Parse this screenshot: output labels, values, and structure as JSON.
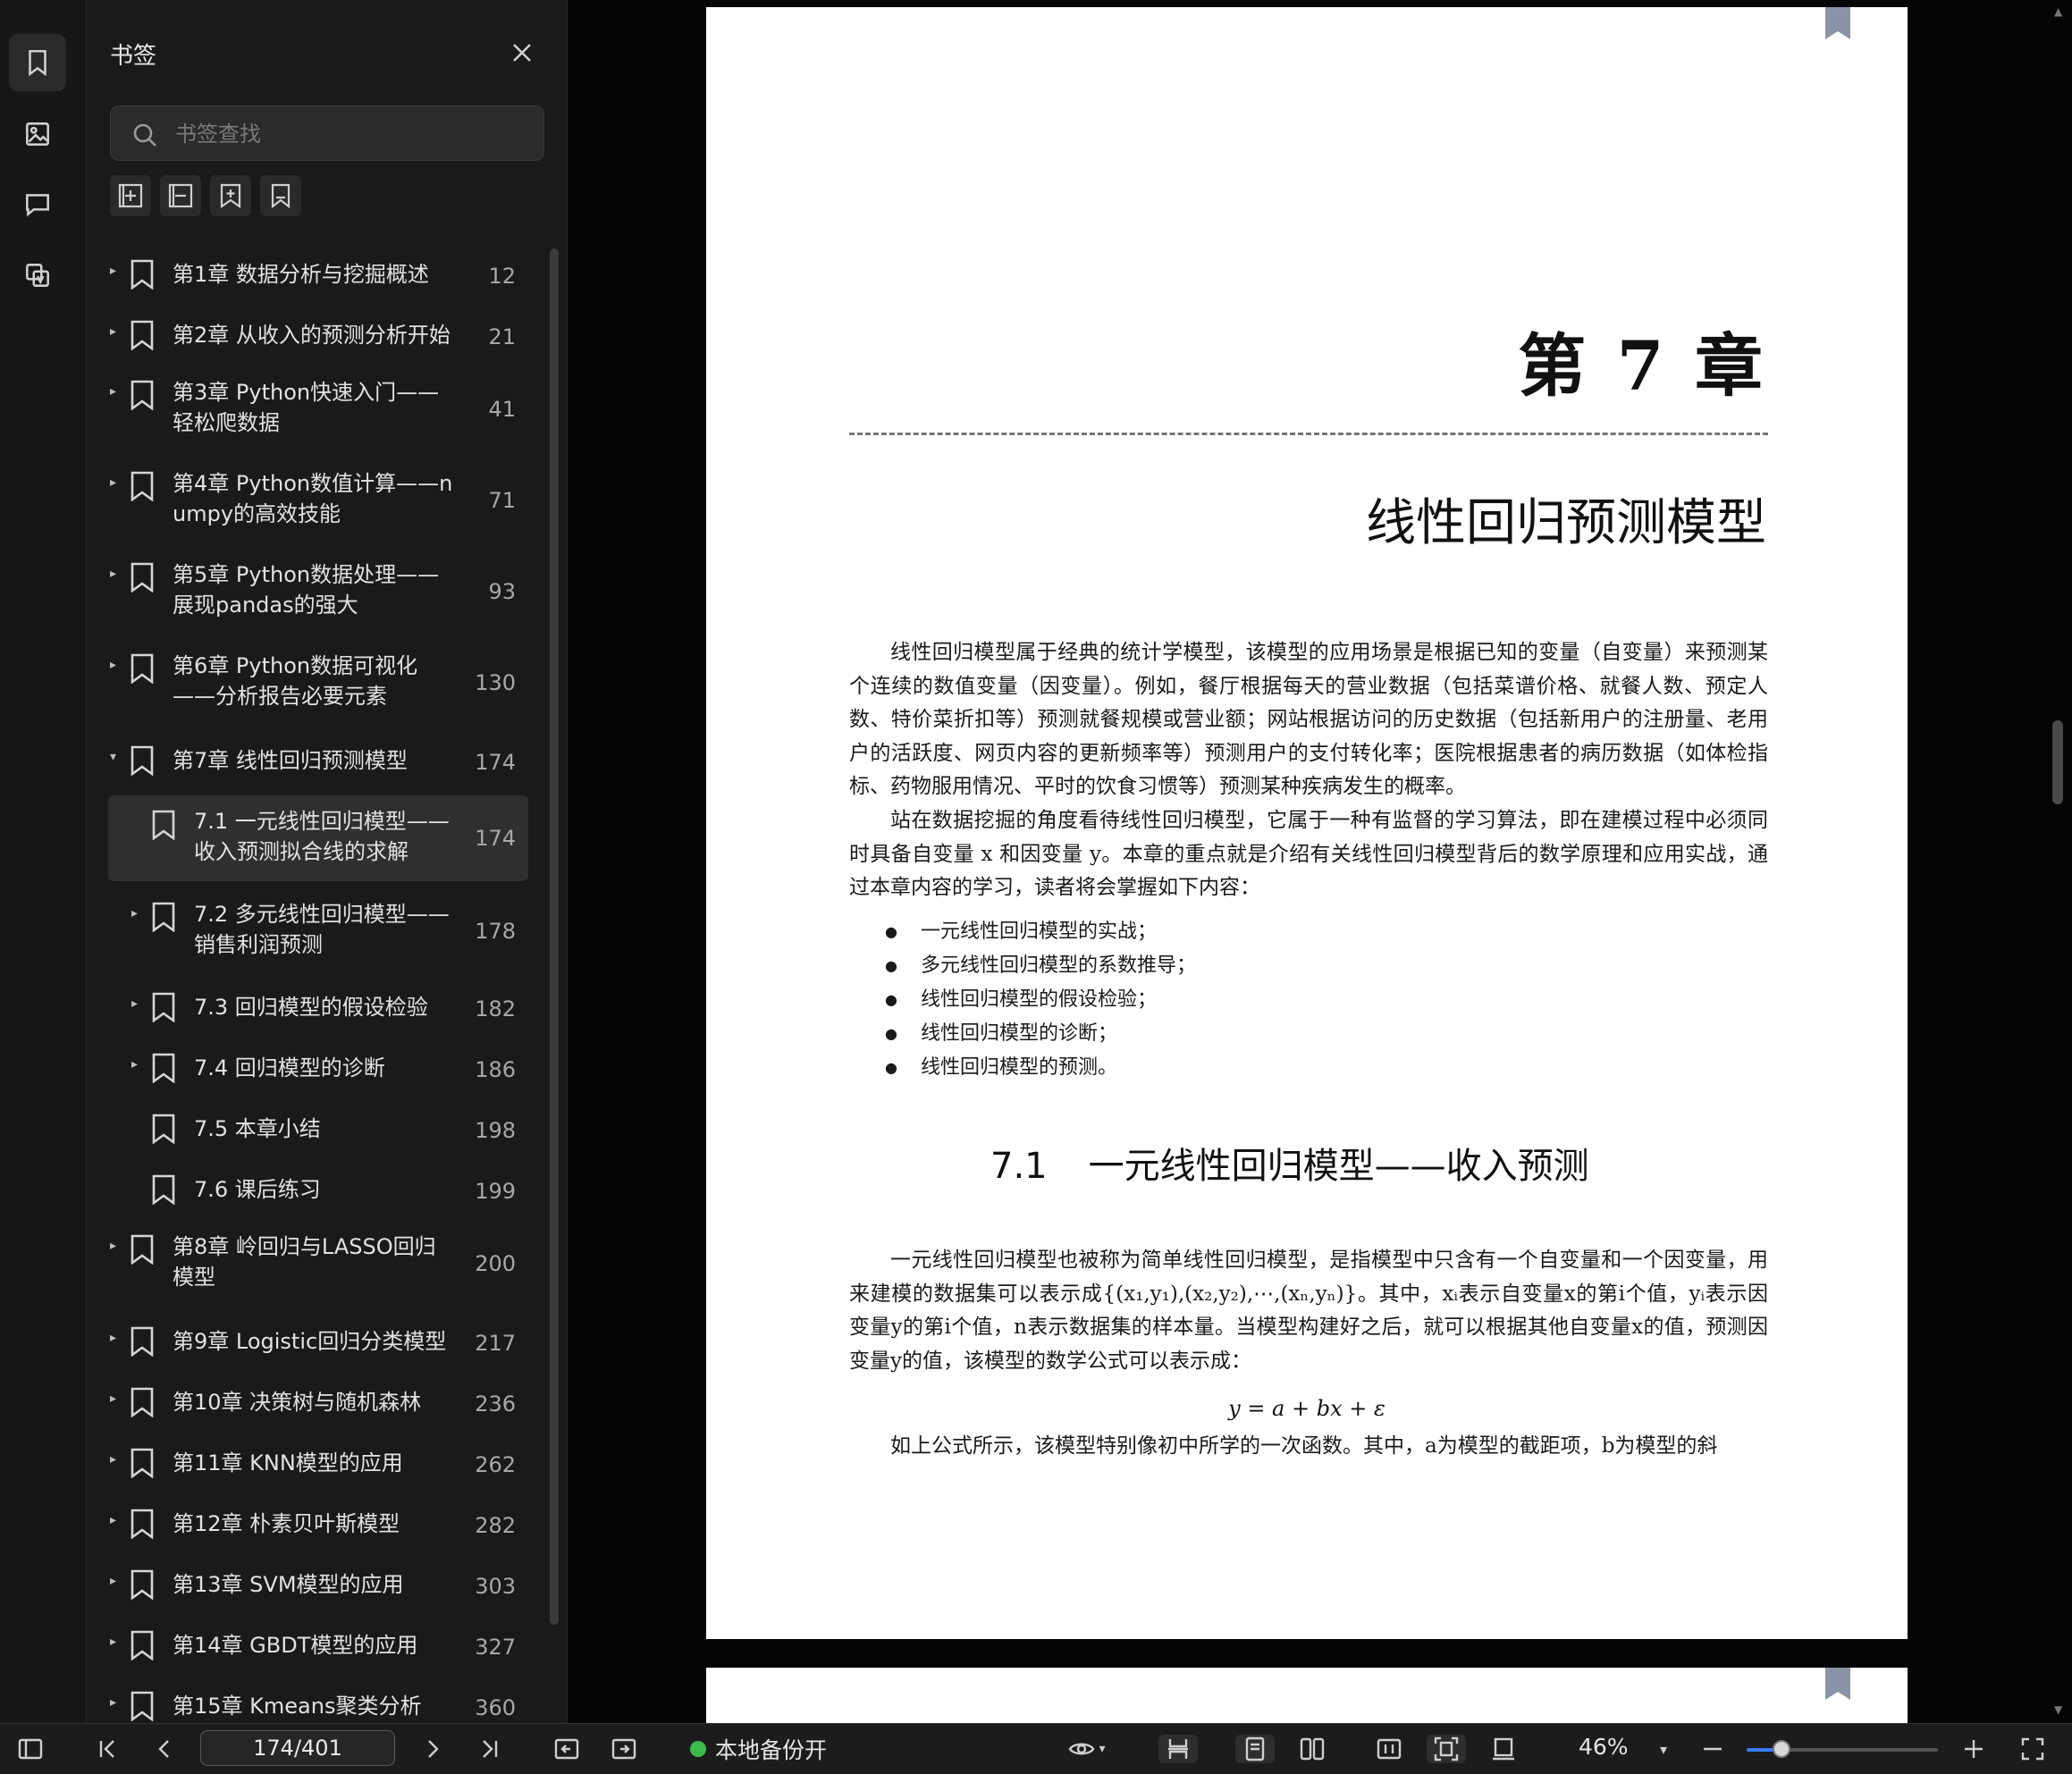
{
  "panel": {
    "title": "书签",
    "search_placeholder": "书签查找"
  },
  "rail_icons": [
    "bookmark-icon",
    "thumbnail-icon",
    "comment-icon",
    "attachment-icon"
  ],
  "toolbar_icons": [
    "expand-all-icon",
    "collapse-all-icon",
    "add-bookmark-icon",
    "bookmark-outline-icon"
  ],
  "bookmarks": [
    {
      "label": "第1章 数据分析与挖掘概述",
      "page": "12"
    },
    {
      "label": "第2章 从收入的预测分析开始",
      "page": "21"
    },
    {
      "label": "第3章 Python快速入门——轻松爬数据",
      "page": "41"
    },
    {
      "label": "第4章 Python数值计算——numpy的高效技能",
      "page": "71"
    },
    {
      "label": "第5章 Python数据处理——展现pandas的强大",
      "page": "93"
    },
    {
      "label": "第6章 Python数据可视化——分析报告必要元素",
      "page": "130"
    },
    {
      "label": "第7章 线性回归预测模型",
      "page": "174"
    },
    {
      "label": "7.1 一元线性回归模型——收入预测拟合线的求解",
      "page": "174"
    },
    {
      "label": "7.2 多元线性回归模型——销售利润预测",
      "page": "178"
    },
    {
      "label": "7.3 回归模型的假设检验",
      "page": "182"
    },
    {
      "label": "7.4 回归模型的诊断",
      "page": "186"
    },
    {
      "label": "7.5 本章小结",
      "page": "198"
    },
    {
      "label": "7.6 课后练习",
      "page": "199"
    },
    {
      "label": "第8章 岭回归与LASSO回归模型",
      "page": "200"
    },
    {
      "label": "第9章 Logistic回归分类模型",
      "page": "217"
    },
    {
      "label": "第10章 决策树与随机森林",
      "page": "236"
    },
    {
      "label": "第11章 KNN模型的应用",
      "page": "262"
    },
    {
      "label": "第12章 朴素贝叶斯模型",
      "page": "282"
    },
    {
      "label": "第13章 SVM模型的应用",
      "page": "303"
    },
    {
      "label": "第14章 GBDT模型的应用",
      "page": "327"
    },
    {
      "label": "第15章 Kmeans聚类分析",
      "page": "360"
    }
  ],
  "document": {
    "chapter_number": "第 7 章",
    "chapter_title": "线性回归预测模型",
    "intro_para1": "线性回归模型属于经典的统计学模型，该模型的应用场景是根据已知的变量（自变量）来预测某个连续的数值变量（因变量）。例如，餐厅根据每天的营业数据（包括菜谱价格、就餐人数、预定人数、特价菜折扣等）预测就餐规模或营业额；网站根据访问的历史数据（包括新用户的注册量、老用户的活跃度、网页内容的更新频率等）预测用户的支付转化率；医院根据患者的病历数据（如体检指标、药物服用情况、平时的饮食习惯等）预测某种疾病发生的概率。",
    "intro_para2": "站在数据挖掘的角度看待线性回归模型，它属于一种有监督的学习算法，即在建模过程中必须同时具备自变量 x 和因变量 y。本章的重点就是介绍有关线性回归模型背后的数学原理和应用实战，通过本章内容的学习，读者将会掌握如下内容：",
    "bullets": [
      "一元线性回归模型的实战；",
      "多元线性回归模型的系数推导；",
      "线性回归模型的假设检验；",
      "线性回归模型的诊断；",
      "线性回归模型的预测。"
    ],
    "section_number": "7.1",
    "section_title": "一元线性回归模型——收入预测",
    "section_para": "一元线性回归模型也被称为简单线性回归模型，是指模型中只含有一个自变量和一个因变量，用来建模的数据集可以表示成{(x₁,y₁),(x₂,y₂),⋯,(xₙ,yₙ)}。其中，xᵢ表示自变量x的第i个值，yᵢ表示因变量y的第i个值，n表示数据集的样本量。当模型构建好之后，就可以根据其他自变量x的值，预测因变量y的值，该模型的数学公式可以表示成：",
    "formula": "y = a + bx + ε",
    "last_para": "如上公式所示，该模型特别像初中所学的一次函数。其中，a为模型的截距项，b为模型的斜"
  },
  "bottom": {
    "page_indicator": "174/401",
    "backup_label": "本地备份开",
    "zoom": "46%",
    "zoom_fraction": 0.18,
    "status_color": "#3dba4e",
    "accent_color": "#3b7bf6"
  }
}
